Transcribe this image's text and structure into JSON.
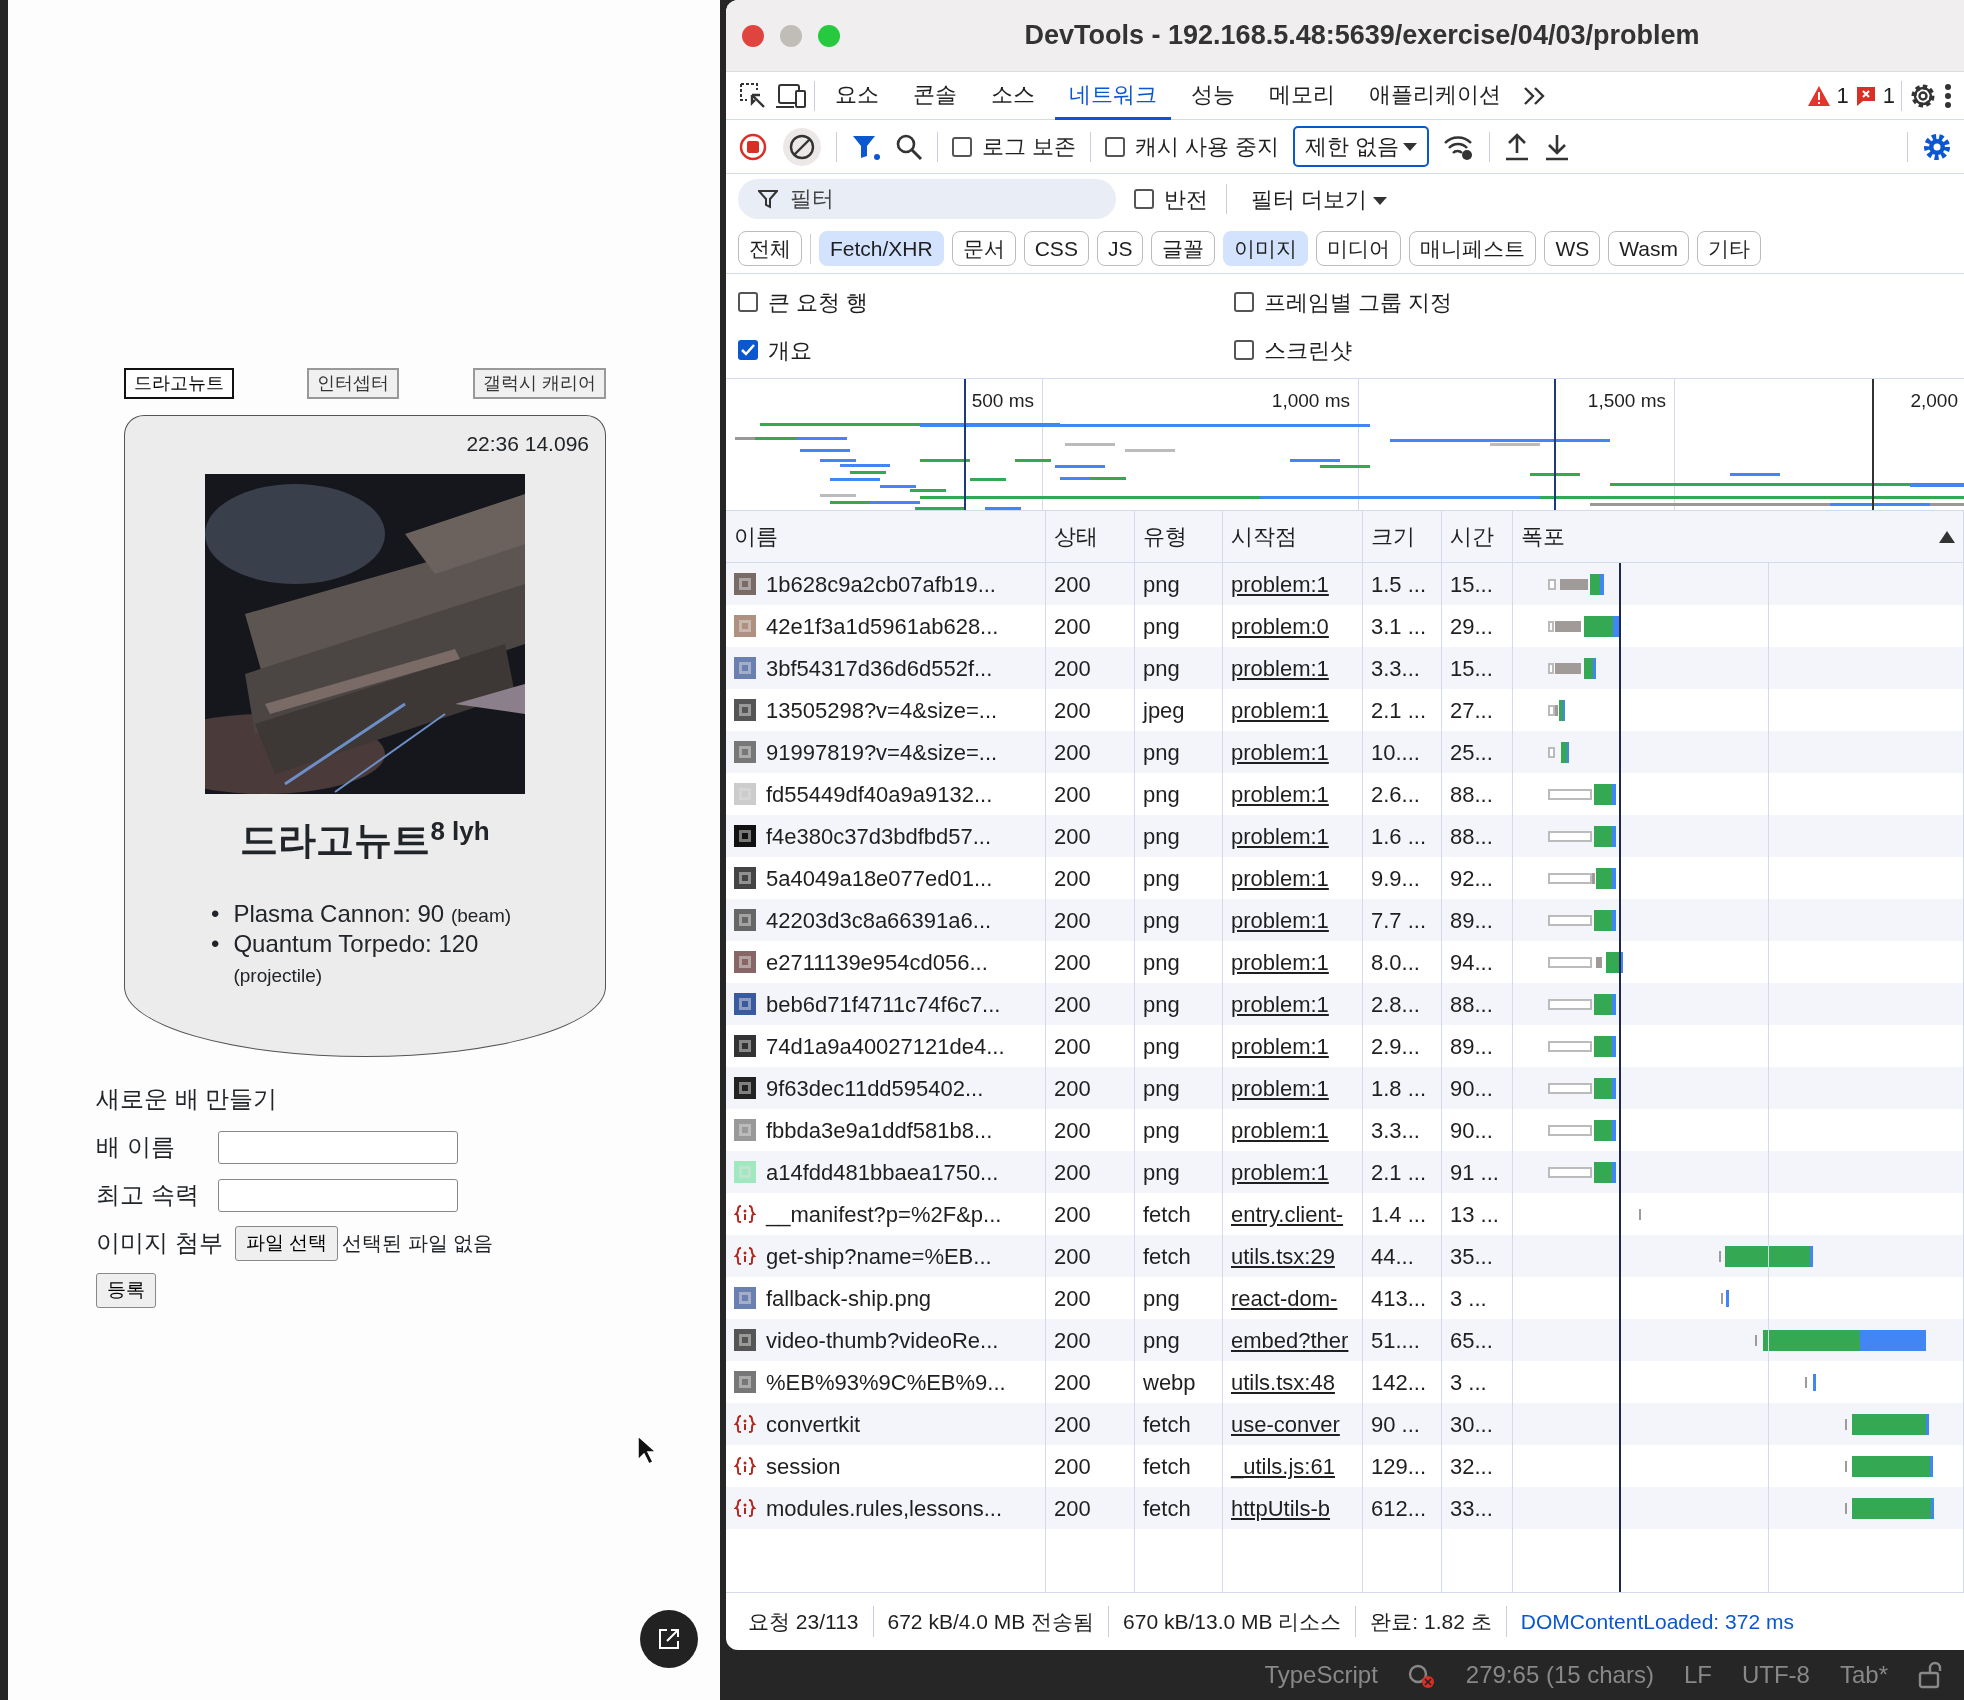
{
  "app": {
    "ship_tabs": [
      {
        "label": "드라고뉴트",
        "selected": true
      },
      {
        "label": "인터셉터",
        "selected": false
      },
      {
        "label": "갤럭시 캐리어",
        "selected": false
      }
    ],
    "card": {
      "time": "22:36 14.096",
      "title": "드라고뉴트$^{8 lyh}$",
      "weapons": [
        {
          "bullet": "•",
          "name": "Plasma Cannon: 90",
          "type": "(beam)"
        },
        {
          "bullet": "•",
          "name": "Quantum Torpedo: 120",
          "type": "(projectile)"
        }
      ]
    },
    "form": {
      "heading": "새로운 배 만들기",
      "fields": [
        {
          "label": "배 이름"
        },
        {
          "label": "최고 속력"
        }
      ],
      "file": {
        "label": "이미지 첨부",
        "button": "파일 선택",
        "status": "선택된 파일 없음"
      },
      "submit": "등록"
    }
  },
  "devtools": {
    "title": "DevTools - 192.168.5.48:5639/exercise/04/03/problem",
    "panels": [
      {
        "label": "요소",
        "selected": false
      },
      {
        "label": "콘솔",
        "selected": false
      },
      {
        "label": "소스",
        "selected": false
      },
      {
        "label": "네트워크",
        "selected": true
      },
      {
        "label": "성능",
        "selected": false
      },
      {
        "label": "메모리",
        "selected": false
      },
      {
        "label": "애플리케이션",
        "selected": false
      }
    ],
    "warnings": "1",
    "errors": "1",
    "toolbar": {
      "preserve_log": {
        "label": "로그 보존",
        "checked": false
      },
      "disable_cache": {
        "label": "캐시 사용 중지",
        "checked": false
      },
      "throttling": "제한 없음"
    },
    "filter": {
      "placeholder": "필터",
      "invert": {
        "label": "반전",
        "checked": false
      },
      "more_filters": "필터 더보기"
    },
    "type_filters": [
      {
        "label": "전체",
        "selected": false
      },
      {
        "label": "Fetch/XHR",
        "selected": true
      },
      {
        "label": "문서",
        "selected": false
      },
      {
        "label": "CSS",
        "selected": false
      },
      {
        "label": "JS",
        "selected": false
      },
      {
        "label": "글꼴",
        "selected": false
      },
      {
        "label": "이미지",
        "selected": true
      },
      {
        "label": "미디어",
        "selected": false
      },
      {
        "label": "매니페스트",
        "selected": false
      },
      {
        "label": "WS",
        "selected": false
      },
      {
        "label": "Wasm",
        "selected": false
      },
      {
        "label": "기타",
        "selected": false
      }
    ],
    "options": [
      {
        "label": "큰 요청 행",
        "checked": false
      },
      {
        "label": "프레임별 그룹 지정",
        "checked": false
      },
      {
        "label": "개요",
        "checked": true
      },
      {
        "label": "스크린샷",
        "checked": false
      }
    ],
    "overview_ticks": [
      "500 ms",
      "1,000 ms",
      "1,500 ms",
      "2,000"
    ],
    "columns": [
      "이름",
      "상태",
      "유형",
      "시작점",
      "크기",
      "시간",
      "폭포"
    ],
    "rows": [
      {
        "name": "1b628c9a2cb07afb19...",
        "status": "200",
        "type": "png",
        "initiator": "problem:1",
        "size": "1.5 ...",
        "time": "15..."
      },
      {
        "name": "42e1f3a1d5961ab628...",
        "status": "200",
        "type": "png",
        "initiator": "problem:0",
        "size": "3.1 ...",
        "time": "29..."
      },
      {
        "name": "3bf54317d36d6d552f...",
        "status": "200",
        "type": "png",
        "initiator": "problem:1",
        "size": "3.3...",
        "time": "15..."
      },
      {
        "name": "13505298?v=4&size=...",
        "status": "200",
        "type": "jpeg",
        "initiator": "problem:1",
        "size": "2.1 ...",
        "time": "27..."
      },
      {
        "name": "91997819?v=4&size=...",
        "status": "200",
        "type": "png",
        "initiator": "problem:1",
        "size": "10....",
        "time": "25..."
      },
      {
        "name": "fd55449df40a9a9132...",
        "status": "200",
        "type": "png",
        "initiator": "problem:1",
        "size": "2.6...",
        "time": "88..."
      },
      {
        "name": "f4e380c37d3bdfbd57...",
        "status": "200",
        "type": "png",
        "initiator": "problem:1",
        "size": "1.6 ...",
        "time": "88..."
      },
      {
        "name": "5a4049a18e077ed01...",
        "status": "200",
        "type": "png",
        "initiator": "problem:1",
        "size": "9.9...",
        "time": "92..."
      },
      {
        "name": "42203d3c8a66391a6...",
        "status": "200",
        "type": "png",
        "initiator": "problem:1",
        "size": "7.7 ...",
        "time": "89..."
      },
      {
        "name": "e2711139e954cd056...",
        "status": "200",
        "type": "png",
        "initiator": "problem:1",
        "size": "8.0...",
        "time": "94..."
      },
      {
        "name": "beb6d71f4711c74f6c7...",
        "status": "200",
        "type": "png",
        "initiator": "problem:1",
        "size": "2.8...",
        "time": "88..."
      },
      {
        "name": "74d1a9a40027121de4...",
        "status": "200",
        "type": "png",
        "initiator": "problem:1",
        "size": "2.9...",
        "time": "89..."
      },
      {
        "name": "9f63dec11dd595402...",
        "status": "200",
        "type": "png",
        "initiator": "problem:1",
        "size": "1.8 ...",
        "time": "90..."
      },
      {
        "name": "fbbda3e9a1ddf581b8...",
        "status": "200",
        "type": "png",
        "initiator": "problem:1",
        "size": "3.3...",
        "time": "90..."
      },
      {
        "name": "a14fdd481bbaea1750...",
        "status": "200",
        "type": "png",
        "initiator": "problem:1",
        "size": "2.1 ...",
        "time": "91 ..."
      },
      {
        "kind": "fetch",
        "name": "__manifest?p=%2F&p...",
        "status": "200",
        "type": "fetch",
        "initiator": "entry.client-",
        "size": "1.4 ...",
        "time": "13 ..."
      },
      {
        "kind": "fetch",
        "name": "get-ship?name=%EB...",
        "status": "200",
        "type": "fetch",
        "initiator": "utils.tsx:29",
        "size": "44...",
        "time": "35..."
      },
      {
        "name": "fallback-ship.png",
        "status": "200",
        "type": "png",
        "initiator": "react-dom-",
        "size": "413...",
        "time": "3 ..."
      },
      {
        "name": "video-thumb?videoRe...",
        "status": "200",
        "type": "png",
        "initiator": "embed?ther",
        "size": "51....",
        "time": "65..."
      },
      {
        "name": "%EB%93%9C%EB%9...",
        "status": "200",
        "type": "webp",
        "initiator": "utils.tsx:48",
        "size": "142...",
        "time": "3 ..."
      },
      {
        "kind": "fetch",
        "name": "convertkit",
        "status": "200",
        "type": "fetch",
        "initiator": "use-conver",
        "size": "90 ...",
        "time": "30..."
      },
      {
        "kind": "fetch",
        "name": "session",
        "status": "200",
        "type": "fetch",
        "initiator": "_utils.js:61",
        "size": "129...",
        "time": "32..."
      },
      {
        "kind": "fetch",
        "name": "modules.rules,lessons...",
        "status": "200",
        "type": "fetch",
        "initiator": "httpUtils-b",
        "size": "612...",
        "time": "33..."
      }
    ],
    "summary": [
      {
        "kind": "plain",
        "text": "요청 23/113"
      },
      {
        "kind": "plain",
        "text": "672 kB/4.0 MB 전송됨"
      },
      {
        "kind": "plain",
        "text": "670 kB/13.0 MB 리소스"
      },
      {
        "kind": "plain",
        "text": "완료: 1.82 초"
      },
      {
        "kind": "dcl",
        "text": "DOMContentLoaded: 372 ms"
      }
    ]
  },
  "editor_status": [
    "TypeScript",
    "279:65 (15 chars)",
    "LF",
    "UTF-8",
    "Tab*"
  ]
}
